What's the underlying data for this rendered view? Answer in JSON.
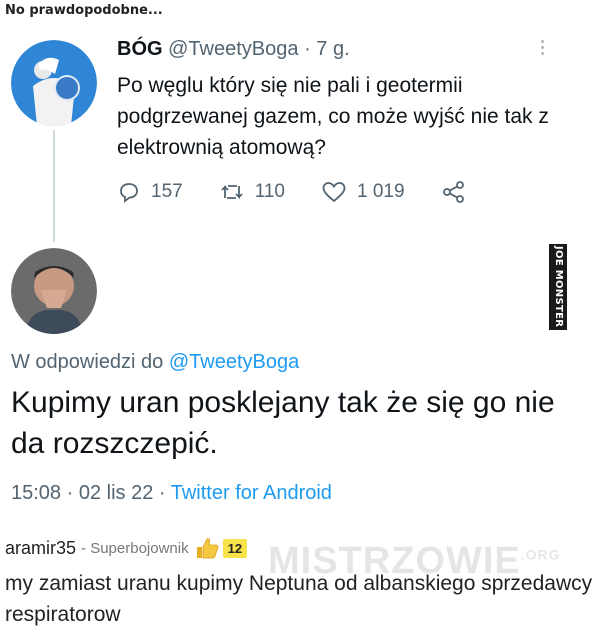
{
  "page": {
    "title": "No prawdopodobne..."
  },
  "tweet": {
    "author_name": "BÓG",
    "author_handle": "@TweetyBoga",
    "age": "· 7 g.",
    "text": "Po węglu który się nie pali i geotermii podgrzewanej gazem, co może wyjść nie tak z elektrownią atomową?",
    "replies": "157",
    "retweets": "110",
    "likes": "1 019"
  },
  "reply": {
    "in_reply_prefix": "W odpowiedzi do",
    "in_reply_handle": "@TweetyBoga",
    "text": "Kupimy uran posklejany tak że się go nie da rozszczepić.",
    "timestamp": "15:08 · 02 lis 22 · ",
    "source": "Twitter for Android"
  },
  "watermarks": {
    "image": "JOE MONSTER",
    "site": "MISTRZOWIE",
    "site_tld": ".ORG"
  },
  "comment": {
    "user": "aramir35",
    "rank": "- Superbojownik",
    "score": "12",
    "text": "my zamiast uranu kupimy Neptuna od albanskiego sprzedawcy respiratorow"
  },
  "colors": {
    "link_blue": "#1d9bf0",
    "muted": "#536471",
    "score_badge": "#f7e24a"
  },
  "icons": [
    "reply-icon",
    "retweet-icon",
    "like-icon",
    "share-icon",
    "more-icon",
    "thumbs-up-icon"
  ]
}
